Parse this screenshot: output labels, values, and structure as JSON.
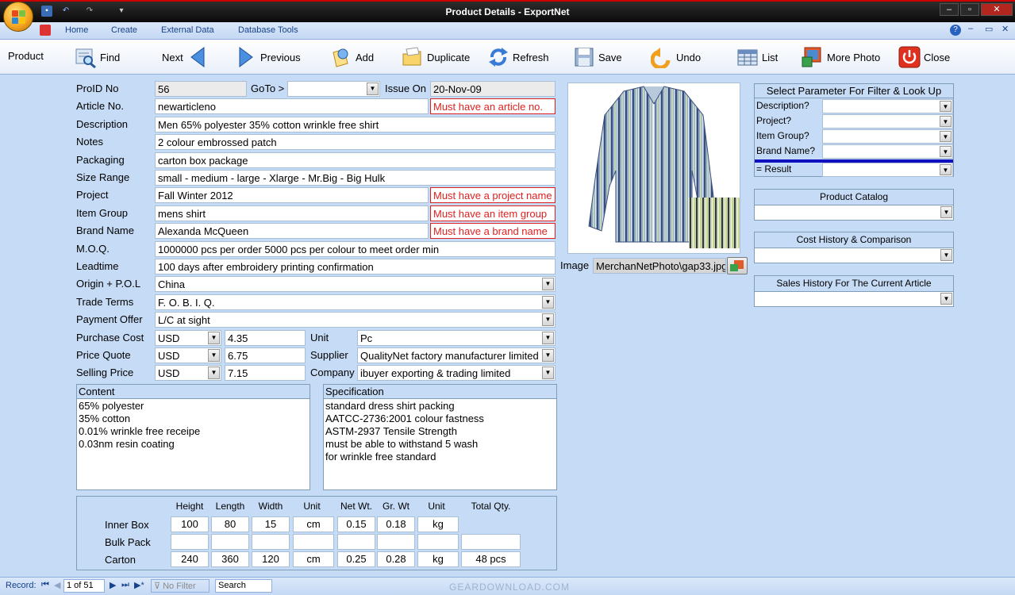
{
  "window": {
    "title": "Product Details - ExportNet"
  },
  "ribbon": {
    "tabs": [
      "Home",
      "Create",
      "External Data",
      "Database Tools"
    ]
  },
  "toolbar": {
    "section_label": "Product",
    "find": "Find",
    "next": "Next",
    "previous": "Previous",
    "add": "Add",
    "duplicate": "Duplicate",
    "refresh": "Refresh",
    "save": "Save",
    "undo": "Undo",
    "list": "List",
    "more_photo": "More Photo",
    "close": "Close"
  },
  "form": {
    "prodid_label": "ProID No",
    "prodid": "56",
    "goto_label": "GoTo >",
    "goto": "",
    "issue_label": "Issue On",
    "issue": "20-Nov-09",
    "article_label": "Article No.",
    "article": "newarticleno",
    "article_err": "Must have an article no.",
    "description_label": "Description",
    "description": "Men 65% polyester 35% cotton wrinkle free shirt",
    "notes_label": "Notes",
    "notes": "2 colour embrossed patch",
    "packaging_label": "Packaging",
    "packaging": "carton box package",
    "size_label": "Size Range",
    "size": "small - medium - large - Xlarge - Mr.Big - Big Hulk",
    "project_label": "Project",
    "project": "Fall Winter 2012",
    "project_err": "Must have a project name",
    "itemgroup_label": "Item Group",
    "itemgroup": "mens shirt",
    "itemgroup_err": "Must have an item group",
    "brand_label": "Brand Name",
    "brand": "Alexanda McQueen",
    "brand_err": "Must have a brand name",
    "moq_label": "M.O.Q.",
    "moq": "1000000 pcs per order 5000 pcs per colour to meet order min",
    "leadtime_label": "Leadtime",
    "leadtime": "100 days after embroidery printing confirmation",
    "origin_label": "Origin + P.O.L",
    "origin": "China",
    "trade_label": "Trade Terms",
    "trade": "F. O. B. I. Q.",
    "payment_label": "Payment Offer",
    "payment": "L/C at sight",
    "purchase_label": "Purchase Cost",
    "purchase_cur": "USD",
    "purchase_val": "4.35",
    "quote_label": "Price Quote",
    "quote_cur": "USD",
    "quote_val": "6.75",
    "selling_label": "Selling Price",
    "selling_cur": "USD",
    "selling_val": "7.15",
    "unit_label": "Unit",
    "unit": "Pc",
    "supplier_label": "Supplier",
    "supplier": "QualityNet factory manufacturer limited",
    "company_label": "Company",
    "company": "ibuyer exporting & trading limited",
    "image_label": "Image",
    "image_path": "MerchanNetPhoto\\gap33.jpg"
  },
  "content": {
    "header": "Content",
    "lines": [
      "65% polyester",
      "35% cotton",
      "0.01% wrinkle free receipe",
      "0.03nm resin coating"
    ]
  },
  "specification": {
    "header": "Specification",
    "lines": [
      "standard dress shirt packing",
      "AATCC-2736:2001 colour fastness",
      "ASTM-2937 Tensile Strength",
      "must be able to withstand 5 wash",
      "for wrinkle free standard"
    ]
  },
  "packing": {
    "headers": [
      "Height",
      "Length",
      "Width",
      "Unit",
      "Net Wt.",
      "Gr. Wt",
      "Unit",
      "Total Qty."
    ],
    "rows": [
      {
        "label": "Inner Box",
        "cells": [
          "100",
          "80",
          "15",
          "cm",
          "0.15",
          "0.18",
          "kg"
        ]
      },
      {
        "label": "Bulk Pack",
        "cells": [
          "",
          "",
          "",
          "",
          "",
          "",
          "",
          ""
        ]
      },
      {
        "label": "Carton",
        "cells": [
          "240",
          "360",
          "120",
          "cm",
          "0.25",
          "0.28",
          "kg",
          "48 pcs"
        ]
      }
    ]
  },
  "filter": {
    "header": "Select Parameter For Filter & Look Up",
    "rows": [
      "Description?",
      "Project?",
      "Item Group?",
      "Brand Name?"
    ],
    "result": "= Result"
  },
  "side_panels": [
    "Product Catalog",
    "Cost History & Comparison",
    "Sales History For The Current Article"
  ],
  "status": {
    "record_label": "Record:",
    "record_pos": "1 of 51",
    "filter": "No Filter",
    "search": "Search",
    "watermark": "GEARDOWNLOAD.COM"
  },
  "colors": {
    "background": "#c6dbf5",
    "error": "#e02020",
    "titlebar": "#111111"
  }
}
